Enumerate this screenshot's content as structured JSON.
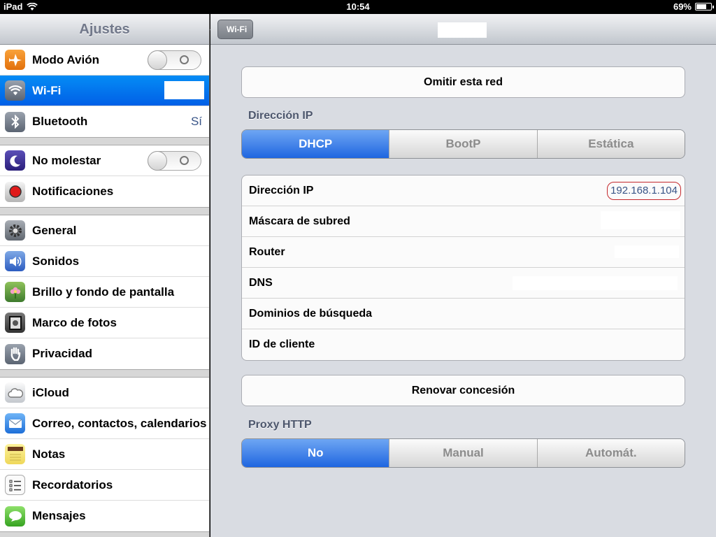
{
  "status_bar": {
    "carrier": "iPad",
    "time": "10:54",
    "battery": "69%",
    "battery_level": 0.69
  },
  "sidebar": {
    "title": "Ajustes",
    "groups": [
      [
        {
          "label": "Modo Avión",
          "icon": "airplane-icon",
          "toggle": false
        },
        {
          "label": "Wi-Fi",
          "icon": "wifi-icon",
          "selected": true
        },
        {
          "label": "Bluetooth",
          "icon": "bluetooth-icon",
          "value": "Sí"
        }
      ],
      [
        {
          "label": "No molestar",
          "icon": "moon-icon",
          "toggle": false
        },
        {
          "label": "Notificaciones",
          "icon": "notifications-icon"
        }
      ],
      [
        {
          "label": "General",
          "icon": "gear-icon"
        },
        {
          "label": "Sonidos",
          "icon": "speaker-icon"
        },
        {
          "label": "Brillo y fondo de pantalla",
          "icon": "flower-icon"
        },
        {
          "label": "Marco de fotos",
          "icon": "photo-frame-icon"
        },
        {
          "label": "Privacidad",
          "icon": "hand-icon"
        }
      ],
      [
        {
          "label": "iCloud",
          "icon": "cloud-icon"
        },
        {
          "label": "Correo, contactos, calendarios",
          "icon": "mail-icon"
        },
        {
          "label": "Notas",
          "icon": "notes-icon"
        },
        {
          "label": "Recordatorios",
          "icon": "reminders-icon"
        },
        {
          "label": "Mensajes",
          "icon": "messages-icon"
        }
      ]
    ]
  },
  "nav": {
    "back_label": "Wi-Fi"
  },
  "main": {
    "forget_network": "Omitir esta red",
    "ip_section_label": "Dirección IP",
    "ip_modes": [
      {
        "label": "DHCP",
        "active": true
      },
      {
        "label": "BootP",
        "active": false
      },
      {
        "label": "Estática",
        "active": false
      }
    ],
    "fields": [
      {
        "label": "Dirección IP",
        "value": "192.168.1.104"
      },
      {
        "label": "Máscara de subred",
        "value": ""
      },
      {
        "label": "Router",
        "value": ""
      },
      {
        "label": "DNS",
        "value": ""
      },
      {
        "label": "Dominios de búsqueda",
        "value": ""
      },
      {
        "label": "ID de cliente",
        "value": ""
      }
    ],
    "renew_lease": "Renovar concesión",
    "proxy_section_label": "Proxy HTTP",
    "proxy_modes": [
      {
        "label": "No",
        "active": true
      },
      {
        "label": "Manual",
        "active": false
      },
      {
        "label": "Automát.",
        "active": false
      }
    ]
  },
  "colors": {
    "accent_blue": "#1f66e0",
    "selected_row": "#0277ee",
    "value_blue": "#385487",
    "highlight_red": "#c4282c"
  }
}
